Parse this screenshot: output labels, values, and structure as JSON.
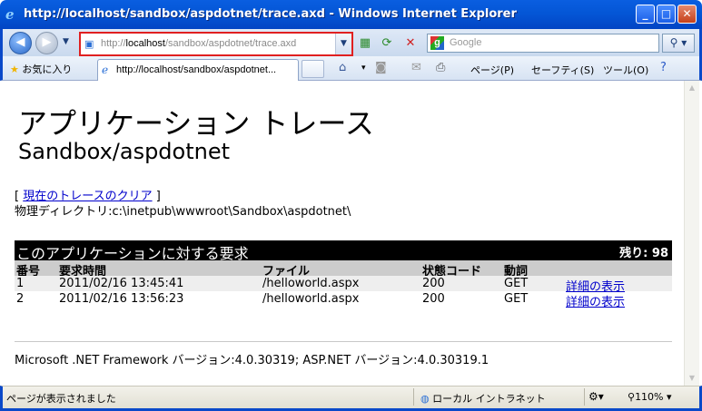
{
  "window": {
    "title": "http://localhost/sandbox/aspdotnet/trace.axd - Windows Internet Explorer",
    "minimize_label": "_",
    "maximize_label": "□",
    "close_label": "✕"
  },
  "address": {
    "url_prefix": "http://",
    "url_host": "localhost",
    "url_path": "/sandbox/aspdotnet/trace.axd",
    "search_placeholder": "Google"
  },
  "toolbar": {
    "favorites_label": "お気に入り",
    "tab_title": "http://localhost/sandbox/aspdotnet...",
    "page_menu": "ページ(P)",
    "safety_menu": "セーフティ(S)",
    "tools_menu": "ツール(O)"
  },
  "page": {
    "heading": "アプリケーション トレース",
    "subheading": "Sandbox/aspdotnet",
    "clear_bracket_open": "[ ",
    "clear_link": "現在のトレースのクリア",
    "clear_bracket_close": " ]",
    "physical_dir_label": "物理ディレクトリ:",
    "physical_dir_value": "c:\\inetpub\\wwwroot\\Sandbox\\aspdotnet\\",
    "requests": {
      "title": "このアプリケーションに対する要求",
      "remaining": "残り: 98",
      "columns": [
        "番号",
        "要求時間",
        "ファイル",
        "状態コード",
        "動詞",
        ""
      ],
      "rows": [
        {
          "no": "1",
          "time": "2011/02/16 13:45:41",
          "file": "/helloworld.aspx",
          "status": "200",
          "verb": "GET",
          "details": "詳細の表示"
        },
        {
          "no": "2",
          "time": "2011/02/16 13:56:23",
          "file": "/helloworld.aspx",
          "status": "200",
          "verb": "GET",
          "details": "詳細の表示"
        }
      ]
    },
    "footer": "Microsoft .NET Framework バージョン:4.0.30319; ASP.NET バージョン:4.0.30319.1"
  },
  "status": {
    "text": "ページが表示されました",
    "zone": "ローカル イントラネット",
    "zoom": "110%"
  }
}
